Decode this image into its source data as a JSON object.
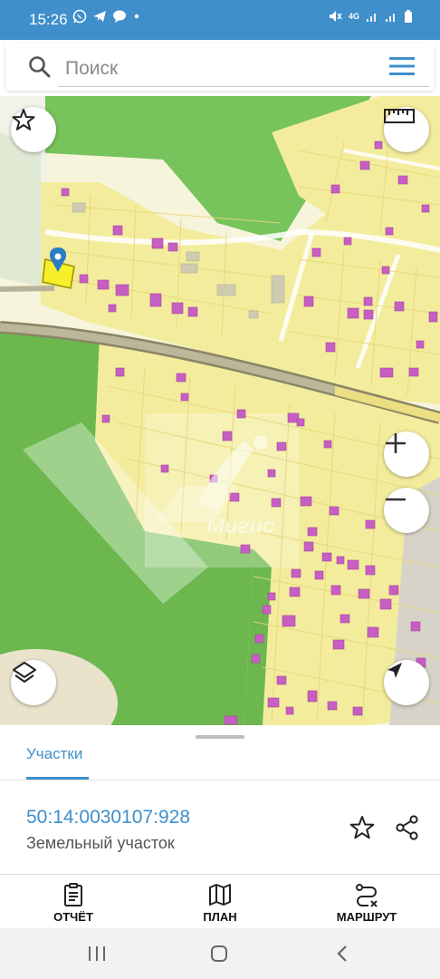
{
  "status": {
    "time": "15:26",
    "left_icons": [
      "whatsapp-icon",
      "telegram-icon",
      "chat-icon",
      "dot-icon"
    ],
    "right_icons": [
      "mute-icon",
      "4g-icon",
      "signal-icon",
      "signal-icon",
      "battery-icon"
    ],
    "network": "4G"
  },
  "search": {
    "placeholder": "Поиск"
  },
  "map": {
    "watermark": "Мигис",
    "colors": {
      "forest": "#77c35c",
      "zone": "#f3ec9c",
      "building": "#c75fc3",
      "road": "#b7b39a",
      "accent": "#3f8fcb"
    },
    "buttons": [
      "favorite",
      "ruler",
      "zoom-in",
      "zoom-out",
      "layers",
      "locate"
    ]
  },
  "sheet": {
    "tab_label": "Участки",
    "parcel_number": "50:14:0030107:928",
    "parcel_type": "Земельный участок"
  },
  "actions": [
    {
      "label": "ОТЧЁТ",
      "icon": "report-icon"
    },
    {
      "label": "ПЛАН",
      "icon": "map-plan-icon"
    },
    {
      "label": "МАРШРУТ",
      "icon": "route-icon"
    }
  ],
  "navbar": [
    "recents-icon",
    "home-icon",
    "back-icon"
  ]
}
